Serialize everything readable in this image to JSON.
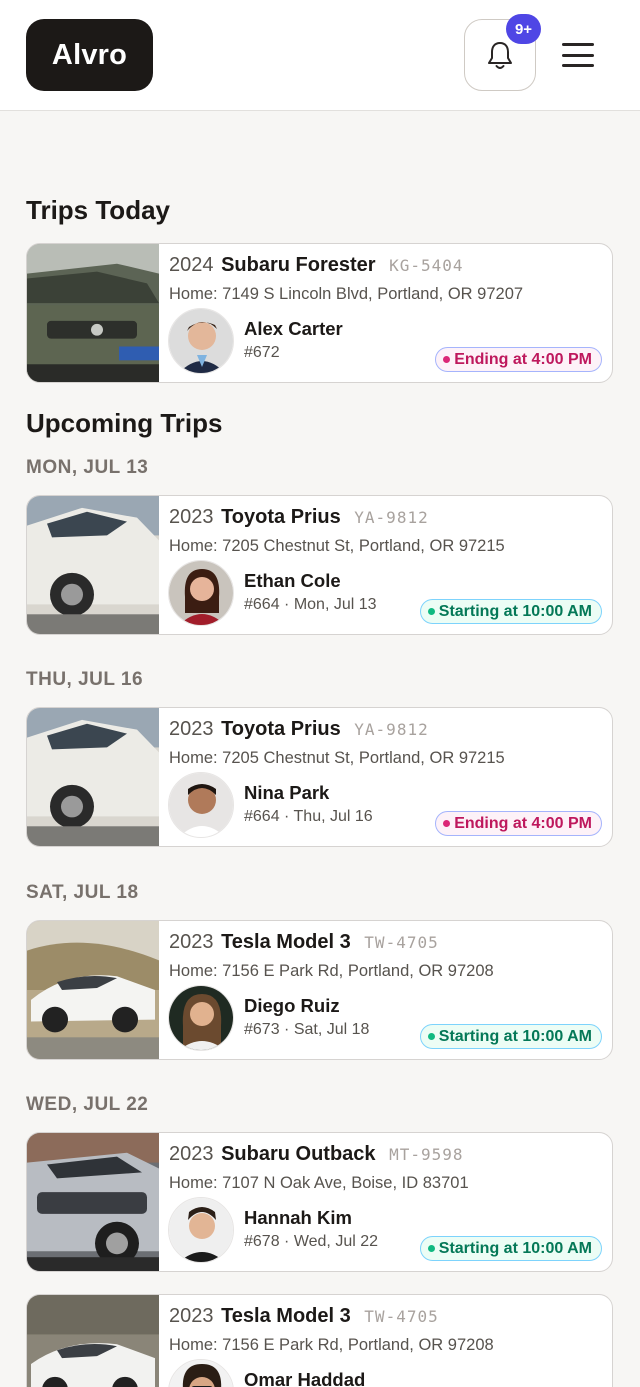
{
  "brand": {
    "name": "Alvro"
  },
  "header": {
    "notification_count": "9+"
  },
  "sections": {
    "today_title": "Trips Today",
    "upcoming_title": "Upcoming Trips"
  },
  "today": {
    "year": "2024",
    "model": "Subaru Forester",
    "plate": "KG-5404",
    "address": "Home: 7149 S Lincoln Blvd, Portland, OR 97207",
    "person": "Alex Carter",
    "meta": "#672",
    "status": "Ending at 4:00 PM",
    "status_type": "ending"
  },
  "upcoming": [
    {
      "date": "MON, JUL 13",
      "year": "2023",
      "model": "Toyota Prius",
      "plate": "YA-9812",
      "address": "Home: 7205 Chestnut St, Portland, OR 97215",
      "person": "Ethan Cole",
      "meta": "#664 · Mon, Jul 13",
      "status": "Starting at 10:00 AM",
      "status_type": "starting"
    },
    {
      "date": "THU, JUL 16",
      "year": "2023",
      "model": "Toyota Prius",
      "plate": "YA-9812",
      "address": "Home: 7205 Chestnut St, Portland, OR 97215",
      "person": "Nina Park",
      "meta": "#664 · Thu, Jul 16",
      "status": "Ending at 4:00 PM",
      "status_type": "ending"
    },
    {
      "date": "SAT, JUL 18",
      "year": "2023",
      "model": "Tesla Model 3",
      "plate": "TW-4705",
      "address": "Home: 7156 E Park Rd, Portland, OR 97208",
      "person": "Diego Ruiz",
      "meta": "#673 · Sat, Jul 18",
      "status": "Starting at 10:00 AM",
      "status_type": "starting"
    },
    {
      "date": "WED, JUL 22",
      "year": "2023",
      "model": "Subaru Outback",
      "plate": "MT-9598",
      "address": "Home: 7107 N Oak Ave, Boise, ID 83701",
      "person": "Hannah Kim",
      "meta": "#678 · Wed, Jul 22",
      "status": "Starting at 10:00 AM",
      "status_type": "starting"
    },
    {
      "year": "2023",
      "model": "Tesla Model 3",
      "plate": "TW-4705",
      "address": "Home: 7156 E Park Rd, Portland, OR 97208",
      "person": "Omar Haddad"
    }
  ],
  "colors": {
    "brand_dark": "#1c1917",
    "badge": "#4f46e5",
    "ending_text": "#be185d",
    "starting_text": "#047857"
  }
}
